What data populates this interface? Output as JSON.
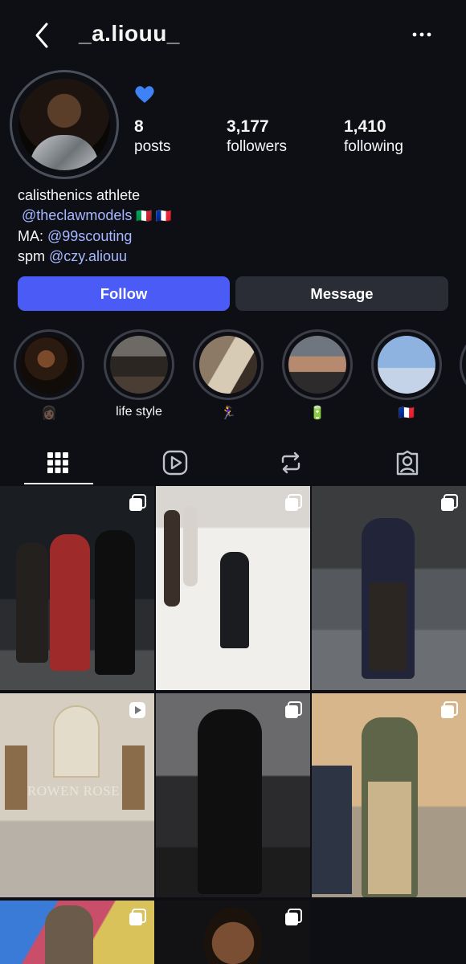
{
  "header": {
    "username": "_a.liouu_",
    "back_icon": "chevron-left-icon",
    "more_icon": "ellipsis-icon"
  },
  "profile": {
    "note_emoji": "blue-heart",
    "stats": {
      "posts_count": "8",
      "posts_label": "posts",
      "followers_count": "3,177",
      "followers_label": "followers",
      "following_count": "1,410",
      "following_label": "following"
    },
    "bio": {
      "line1": "calisthenics athlete",
      "line2_mention": "@theclawmodels",
      "line2_flags": "🇮🇹 🇫🇷",
      "line3_prefix": "MA: ",
      "line3_mention": "@99scouting",
      "line4_prefix": "spm ",
      "line4_mention": "@czy.aliouu"
    }
  },
  "actions": {
    "follow_label": "Follow",
    "message_label": "Message",
    "follow_color": "#4b5bf6"
  },
  "highlights": [
    {
      "caption": "👩🏿"
    },
    {
      "caption": "life style"
    },
    {
      "caption": "🏃‍♀️"
    },
    {
      "caption": "🔋"
    },
    {
      "caption": "🇫🇷"
    }
  ],
  "tabs": [
    {
      "icon": "grid-icon",
      "active": true
    },
    {
      "icon": "reels-icon",
      "active": false
    },
    {
      "icon": "repost-icon",
      "active": false
    },
    {
      "icon": "tagged-icon",
      "active": false
    }
  ],
  "posts": [
    {
      "type": "carousel",
      "text": ""
    },
    {
      "type": "carousel",
      "text": ""
    },
    {
      "type": "carousel",
      "text": ""
    },
    {
      "type": "reel",
      "text": "ROWEN ROSE"
    },
    {
      "type": "carousel",
      "text": ""
    },
    {
      "type": "carousel",
      "text": ""
    },
    {
      "type": "carousel",
      "text": ""
    },
    {
      "type": "carousel",
      "text": ""
    }
  ]
}
